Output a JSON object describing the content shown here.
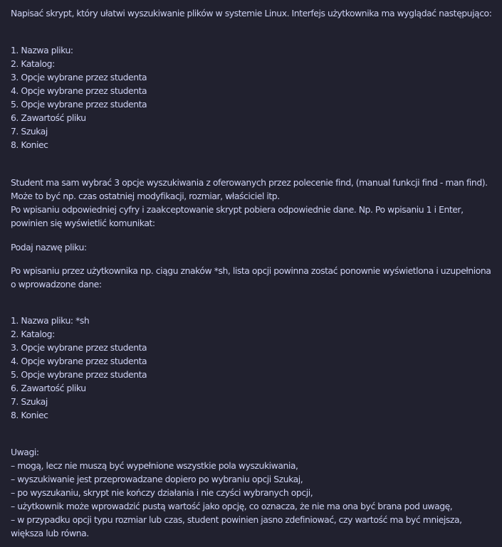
{
  "intro": "Napisać skrypt, który ułatwi wyszukiwanie plików w systemie Linux. Interfejs użytkownika ma wyglądać następująco:",
  "menu_initial": [
    "1. Nazwa pliku:",
    "2. Katalog:",
    "3. Opcje wybrane przez studenta",
    "4. Opcje wybrane przez studenta",
    "5. Opcje wybrane przez studenta",
    "6. Zawartość pliku",
    "7. Szukaj",
    "8. Koniec"
  ],
  "para_options": "Student ma sam wybrać 3 opcje wyszukiwania z oferowanych przez polecenie find, (manual funkcji find - man find). Może to być np. czas ostatniej modyfikacji, rozmiar, właściciel itp.",
  "para_input": "Po wpisaniu odpowiedniej cyfry i zaakceptowanie skrypt pobiera odpowiednie dane. Np. Po wpisaniu 1 i Enter, powinien się wyświetlić komunikat:",
  "prompt_text": "Podaj nazwę pliku:",
  "para_after": "Po wpisaniu przez użytkownika np. ciągu znaków *sh, lista opcji powinna zostać ponownie wyświetlona i uzupełniona o wprowadzone dane:",
  "menu_filled": [
    "1. Nazwa pliku: *sh",
    "2. Katalog:",
    "3. Opcje wybrane przez studenta",
    "4. Opcje wybrane przez studenta",
    "5. Opcje wybrane przez studenta",
    "6. Zawartość pliku",
    "7. Szukaj",
    "8. Koniec"
  ],
  "notes": {
    "title": "Uwagi:",
    "items": [
      "– mogą, lecz nie muszą być wypełnione wszystkie pola wyszukiwania,",
      "– wyszukiwanie jest przeprowadzane dopiero po wybraniu opcji Szukaj,",
      "– po wyszukaniu, skrypt nie kończy działania i nie czyści wybranych opcji,",
      "– użytkownik może wprowadzić pustą wartość jako opcję, co oznacza, że nie ma ona być brana pod uwagę,",
      "– w przypadku opcji typu rozmiar lub czas, student powinien jasno zdefiniować, czy wartość ma być mniejsza, większa lub równa."
    ]
  },
  "colors": {
    "background": "#21212f",
    "text": "#ced2f4"
  }
}
